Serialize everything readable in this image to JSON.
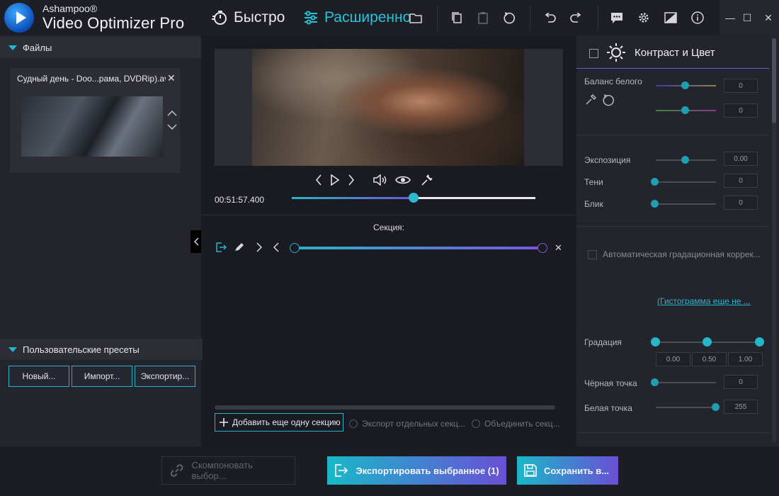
{
  "app": {
    "brand_top": "Ashampoo®",
    "brand_name": "Video Optimizer Pro"
  },
  "toolbar": {
    "mode_fast": "Быстро",
    "mode_advanced": "Расширенно",
    "icons": [
      "folder-icon",
      "copy-icon",
      "clipboard-icon",
      "reset-icon",
      "undo-icon",
      "redo-icon",
      "feedback-icon",
      "gear-icon",
      "compare-icon",
      "info-icon"
    ],
    "accent": "#25c4d8"
  },
  "window": {
    "minimize": "—",
    "maximize": "☐",
    "close": "✕"
  },
  "files_panel": {
    "header": "Файлы",
    "file_name": "Судный день - Doo...рама, DVDRip).avi"
  },
  "presets_panel": {
    "header": "Пользовательские пресеты",
    "new_label": "Новый...",
    "import_label": "Импорт...",
    "export_label": "Экспортир..."
  },
  "player": {
    "timecode": "00:51:57.400",
    "progress": 0.5
  },
  "section": {
    "label": "Секция:",
    "add_label": "Добавить еще одну секцию",
    "export_separate_label": "Экспорт отдельных секц...",
    "merge_label": "Объединить секц..."
  },
  "adjust": {
    "title": "Контраст и Цвет",
    "white_balance_label": "Баланс белого",
    "wb_value1": "0",
    "wb_value2": "0",
    "exposure_label": "Экспозиция",
    "exposure_value": "0.00",
    "shadows_label": "Тени",
    "shadows_value": "0",
    "highlights_label": "Блик",
    "highlights_value": "0",
    "auto_grad_label": "Автоматическая градационная коррек...",
    "histogram_link": "(Гистограмма еще не ...",
    "gradation_label": "Градация",
    "grad_low": "0.00",
    "grad_mid": "0.50",
    "grad_high": "1.00",
    "black_point_label": "Чёрная точка",
    "black_point_value": "0",
    "white_point_label": "Белая точка",
    "white_point_value": "255"
  },
  "footer": {
    "compose_label": "Скомпоновать выбор...",
    "export_selected_label": "Экспортировать выбранное (1)",
    "save_label": "Сохранить в..."
  }
}
